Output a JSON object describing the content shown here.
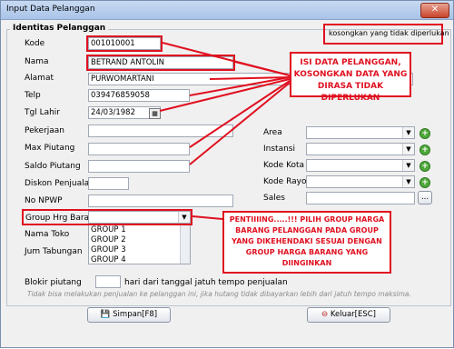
{
  "window": {
    "title": "Input Data Pelanggan",
    "close": "✕"
  },
  "group": {
    "legend": "Identitas Pelanggan"
  },
  "note_top": "kosongkan yang tidak diperlukan",
  "fields": {
    "kode": {
      "label": "Kode",
      "value": "001010001"
    },
    "nama": {
      "label": "Nama",
      "value": "BETRAND ANTOLIN"
    },
    "alamat": {
      "label": "Alamat",
      "value": "PURWOMARTANI"
    },
    "telp": {
      "label": "Telp",
      "value": "039476859058"
    },
    "tgl_lahir": {
      "label": "Tgl Lahir",
      "value": "24/03/1982"
    },
    "pekerjaan": {
      "label": "Pekerjaan",
      "value": ""
    },
    "max_piutang": {
      "label": "Max Piutang",
      "value": ""
    },
    "saldo_piutang": {
      "label": "Saldo Piutang",
      "value": ""
    },
    "diskon": {
      "label": "Diskon Penjualan",
      "value": ""
    },
    "npwp": {
      "label": "No NPWP",
      "value": ""
    },
    "group_hrg": {
      "label": "Group Hrg Barang"
    },
    "nama_toko": {
      "label": "Nama Toko"
    },
    "jum_tabungan": {
      "label": "Jum Tabungan"
    },
    "blokir": {
      "label": "Blokir piutang",
      "suffix": "hari dari tanggal jatuh tempo penjualan"
    }
  },
  "right_fields": {
    "area": "Area",
    "instansi": "Instansi",
    "kode_kota": "Kode Kota",
    "kode_rayon": "Kode Rayon",
    "sales": "Sales",
    "sales_btn": "..."
  },
  "group_options": [
    "GROUP 1",
    "GROUP 2",
    "GROUP 3",
    "GROUP 4"
  ],
  "callout1": "ISI DATA PELANGGAN, KOSONGKAN DATA YANG DIRASA TIDAK DIPERLUKAN",
  "callout2": "PENTIIIING.....!!! PILIH GROUP HARGA BARANG PELANGGAN PADA GROUP YANG DIKEHENDAKI SESUAI DENGAN GROUP HARGA BARANG YANG DIINGINKAN",
  "footnote": "Tidak bisa melakukan penjualan ke pelanggan ini, jika hutang tidak dibayarkan lebih dari jatuh tempo maksima.",
  "buttons": {
    "save": "Simpan[F8]",
    "exit": "Keluar[ESC]"
  },
  "colors": {
    "annotation_red": "#e01020",
    "title_bar": "#a9c3e8"
  }
}
